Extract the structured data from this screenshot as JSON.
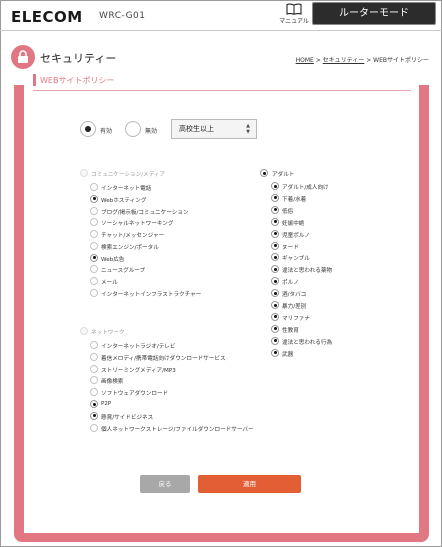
{
  "header": {
    "logo": "ELECOM",
    "model": "WRC-G01",
    "manual_label": "マニュアル",
    "mode_button": "ルーターモード"
  },
  "page": {
    "title": "セキュリティー",
    "breadcrumb": {
      "home": "HOME",
      "sep1": " > ",
      "security": "セキュリティー",
      "sep2": " > ",
      "current": "WEBサイトポリシー"
    }
  },
  "section": {
    "title": "WEBサイトポリシー"
  },
  "filter": {
    "enabled_label": "有効",
    "disabled_label": "無効",
    "enabled_selected": true,
    "level_value": "高校生以上"
  },
  "groups": {
    "communication": {
      "label": "コミュニケーション/メディア",
      "items": [
        {
          "label": "インターネット電話",
          "checked": false
        },
        {
          "label": "Webホスティング",
          "checked": true
        },
        {
          "label": "ブログ/掲示板/コミュニケーション",
          "checked": false
        },
        {
          "label": "ソーシャルネットワーキング",
          "checked": false
        },
        {
          "label": "チャット/メッセンジャー",
          "checked": false
        },
        {
          "label": "検索エンジン/ポータル",
          "checked": false
        },
        {
          "label": "Web広告",
          "checked": true
        },
        {
          "label": "ニュースグループ",
          "checked": false
        },
        {
          "label": "メール",
          "checked": false
        },
        {
          "label": "インターネットインフラストラクチャー",
          "checked": false
        }
      ]
    },
    "network": {
      "label": "ネットワーク",
      "items": [
        {
          "label": "インターネットラジオ/テレビ",
          "checked": false
        },
        {
          "label": "着信メロディ/携帯電話向けダウンロードサービス",
          "checked": false
        },
        {
          "label": "ストリーミングメディア/MP3",
          "checked": false
        },
        {
          "label": "画像検索",
          "checked": false
        },
        {
          "label": "ソフトウェアダウンロード",
          "checked": false
        },
        {
          "label": "P2P",
          "checked": true
        },
        {
          "label": "懸賞/サイドビジネス",
          "checked": true
        },
        {
          "label": "個人ネットワークストレージ/ファイルダウンロードサーバー",
          "checked": false
        }
      ]
    },
    "adult": {
      "label": "アダルト",
      "items": [
        {
          "label": "アダルト/成人向け",
          "checked": true
        },
        {
          "label": "下着/水着",
          "checked": true
        },
        {
          "label": "低俗",
          "checked": true
        },
        {
          "label": "妊娠中絶",
          "checked": true
        },
        {
          "label": "児童ポルノ",
          "checked": true
        },
        {
          "label": "ヌード",
          "checked": true
        },
        {
          "label": "ギャンブル",
          "checked": true
        },
        {
          "label": "違法と思われる薬物",
          "checked": true
        },
        {
          "label": "ポルノ",
          "checked": true
        },
        {
          "label": "酒/タバコ",
          "checked": true
        },
        {
          "label": "暴力/差別",
          "checked": true
        },
        {
          "label": "マリファナ",
          "checked": true
        },
        {
          "label": "性教育",
          "checked": true
        },
        {
          "label": "違法と思われる行為",
          "checked": true
        },
        {
          "label": "武器",
          "checked": true
        }
      ]
    }
  },
  "buttons": {
    "back": "戻る",
    "apply": "適用"
  }
}
